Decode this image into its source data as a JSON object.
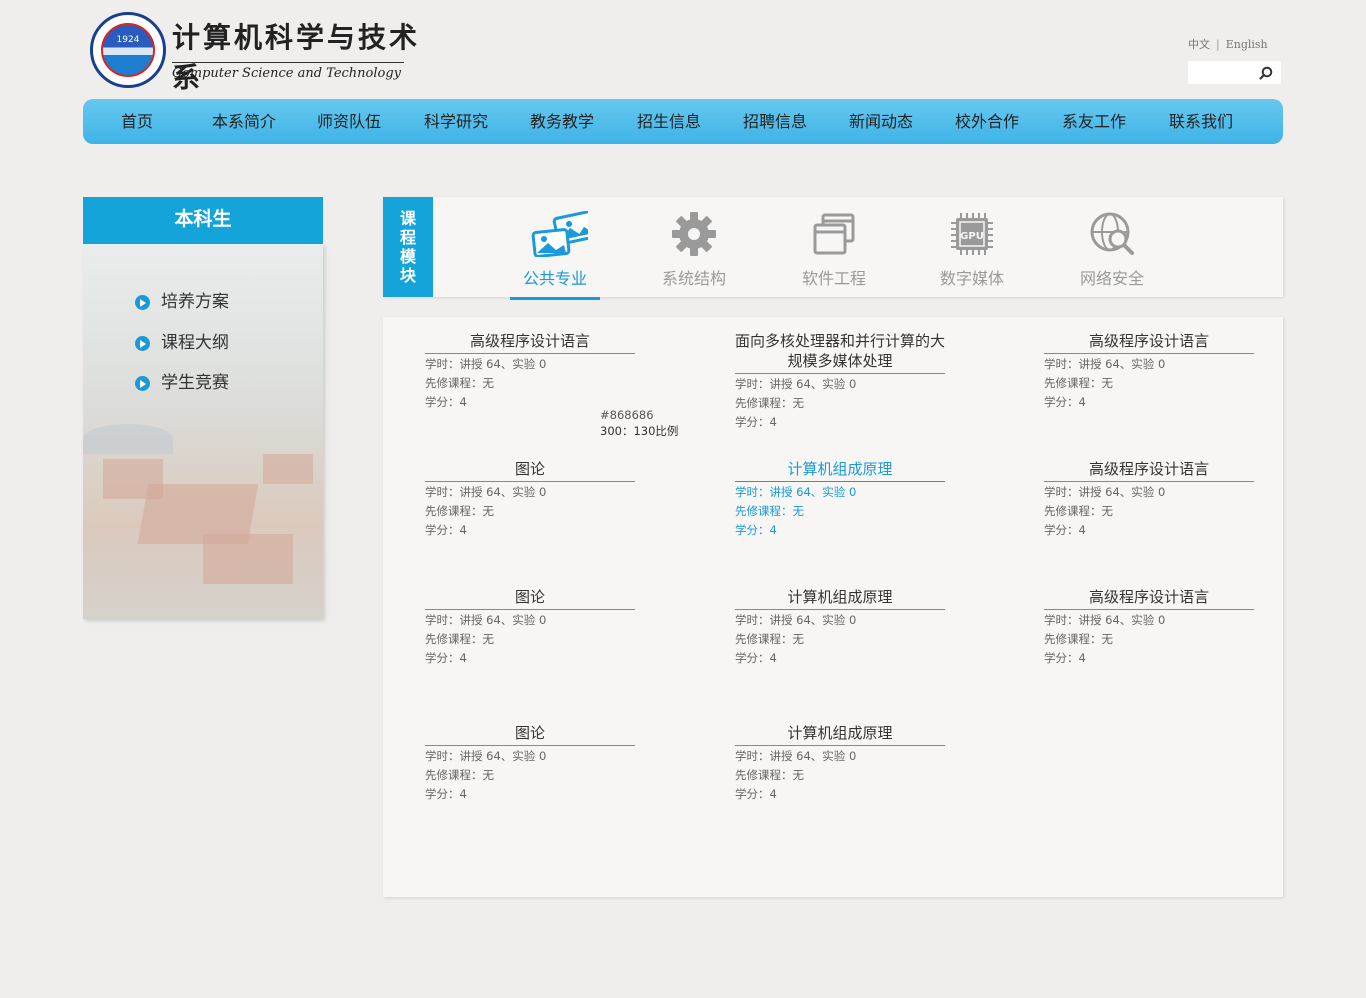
{
  "header": {
    "emblem_year": "1924",
    "title": "计算机科学与技术系",
    "subtitle": "Computer Science and Technology",
    "lang": {
      "zh": "中文",
      "sep": "|",
      "en": "English"
    },
    "search": {
      "value": "",
      "placeholder": ""
    }
  },
  "nav": [
    "首页",
    "本系简介",
    "师资队伍",
    "科学研究",
    "教务教学",
    "招生信息",
    "招聘信息",
    "新闻动态",
    "校外合作",
    "系友工作",
    "联系我们"
  ],
  "sidebar": {
    "title": "本科生",
    "items": [
      "培养方案",
      "课程大纲",
      "学生竞赛"
    ]
  },
  "module": {
    "tag": [
      "课",
      "程",
      "模",
      "块"
    ],
    "tabs": [
      {
        "label": "公共专业",
        "icon": "picture-icon",
        "active": true
      },
      {
        "label": "系统结构",
        "icon": "gear-icon",
        "active": false
      },
      {
        "label": "软件工程",
        "icon": "windows-icon",
        "active": false
      },
      {
        "label": "数字媒体",
        "icon": "gpu-chip-icon",
        "active": false
      },
      {
        "label": "网络安全",
        "icon": "globe-search-icon",
        "active": false
      }
    ],
    "accent": "#1a9ad6"
  },
  "courses": [
    {
      "title": "高级程序设计语言",
      "hours": "学时：讲授 64、实验 0",
      "prereq": "先修课程：无",
      "credit": "学分：4"
    },
    {
      "title": "面向多核处理器和并行计算的大规模多媒体处理",
      "hours": "学时：讲授 64、实验 0",
      "prereq": "先修课程：无",
      "credit": "学分：4"
    },
    {
      "title": "高级程序设计语言",
      "hours": "学时：讲授 64、实验 0",
      "prereq": "先修课程：无",
      "credit": "学分：4"
    },
    {
      "title": "图论",
      "hours": "学时：讲授 64、实验 0",
      "prereq": "先修课程：无",
      "credit": "学分：4"
    },
    {
      "title": "计算机组成原理",
      "hours": "学时：讲授 64、实验 0",
      "prereq": "先修课程：无",
      "credit": "学分：4",
      "highlighted": true
    },
    {
      "title": "高级程序设计语言",
      "hours": "学时：讲授 64、实验 0",
      "prereq": "先修课程：无",
      "credit": "学分：4"
    },
    {
      "title": "图论",
      "hours": "学时：讲授 64、实验 0",
      "prereq": "先修课程：无",
      "credit": "学分：4"
    },
    {
      "title": "计算机组成原理",
      "hours": "学时：讲授 64、实验 0",
      "prereq": "先修课程：无",
      "credit": "学分：4"
    },
    {
      "title": "高级程序设计语言",
      "hours": "学时：讲授 64、实验 0",
      "prereq": "先修课程：无",
      "credit": "学分：4"
    },
    {
      "title": "图论",
      "hours": "学时：讲授 64、实验 0",
      "prereq": "先修课程：无",
      "credit": "学分：4"
    },
    {
      "title": "计算机组成原理",
      "hours": "学时：讲授 64、实验 0",
      "prereq": "先修课程：无",
      "credit": "学分：4"
    }
  ],
  "annotation": {
    "color": "#868686",
    "ratio": "300：130比例"
  }
}
